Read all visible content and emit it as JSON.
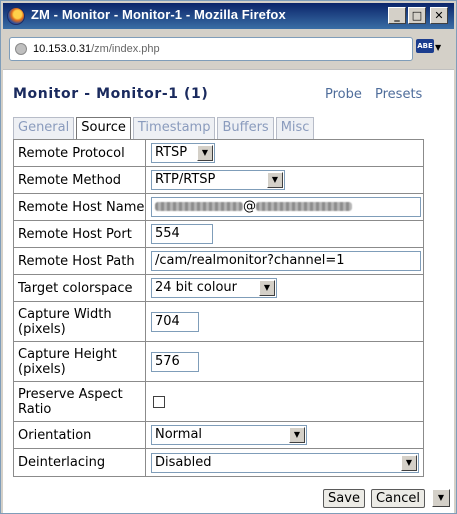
{
  "window": {
    "title": "ZM - Monitor - Monitor-1 - Mozilla Firefox",
    "minimize": "_",
    "maximize": "□",
    "close": "✕"
  },
  "address": {
    "host": "10.153.0.31",
    "path": "/zm/index.php",
    "addon_label": "ABE",
    "addon_arrow": "▼"
  },
  "page": {
    "title": "Monitor - Monitor-1 (1)",
    "links": [
      "Probe",
      "Presets"
    ]
  },
  "tabs": [
    {
      "label": "General",
      "active": false
    },
    {
      "label": "Source",
      "active": true
    },
    {
      "label": "Timestamp",
      "active": false
    },
    {
      "label": "Buffers",
      "active": false
    },
    {
      "label": "Misc",
      "active": false
    }
  ],
  "form": {
    "remote_protocol": {
      "label": "Remote Protocol",
      "value": "RTSP"
    },
    "remote_method": {
      "label": "Remote Method",
      "value": "RTP/RTSP"
    },
    "remote_host_name": {
      "label": "Remote Host Name",
      "value_visible": "@"
    },
    "remote_host_port": {
      "label": "Remote Host Port",
      "value": "554"
    },
    "remote_host_path": {
      "label": "Remote Host Path",
      "value": "/cam/realmonitor?channel=1"
    },
    "target_colorspace": {
      "label": "Target colorspace",
      "value": "24 bit colour"
    },
    "capture_width": {
      "label": "Capture Width (pixels)",
      "value": "704"
    },
    "capture_height": {
      "label": "Capture Height (pixels)",
      "value": "576"
    },
    "preserve_aspect": {
      "label": "Preserve Aspect Ratio",
      "checked": false
    },
    "orientation": {
      "label": "Orientation",
      "value": "Normal"
    },
    "deinterlacing": {
      "label": "Deinterlacing",
      "value": "Disabled"
    }
  },
  "buttons": {
    "save": "Save",
    "cancel": "Cancel"
  },
  "icons": {
    "dropdown_arrow": "▼"
  }
}
